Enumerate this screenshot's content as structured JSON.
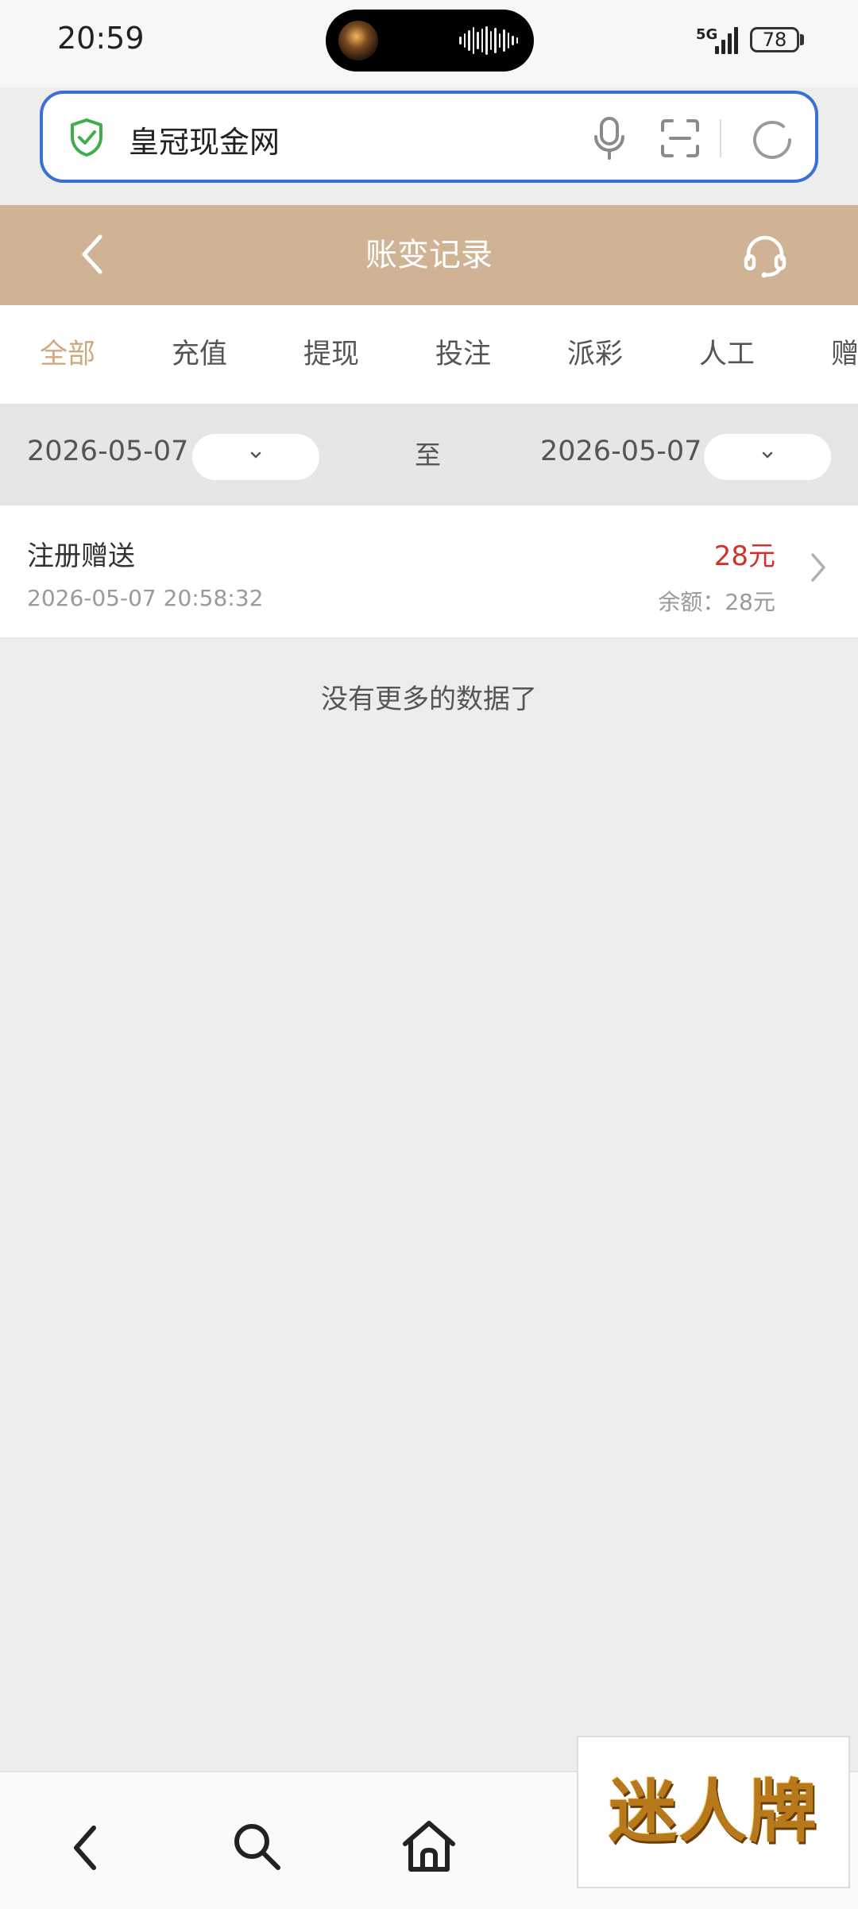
{
  "status_bar": {
    "time": "20:59",
    "network": "5G",
    "battery": "78"
  },
  "search": {
    "query": "皇冠现金网"
  },
  "header": {
    "title": "账变记录"
  },
  "tabs": [
    {
      "label": "全部",
      "active": true
    },
    {
      "label": "充值"
    },
    {
      "label": "提现"
    },
    {
      "label": "投注"
    },
    {
      "label": "派彩"
    },
    {
      "label": "人工"
    },
    {
      "label": "赠"
    }
  ],
  "filter": {
    "start_date": "2026-05-07",
    "separator": "至",
    "end_date": "2026-05-07"
  },
  "records": [
    {
      "title": "注册赠送",
      "time": "2026-05-07 20:58:32",
      "amount": "28元",
      "balance": "余额：28元"
    }
  ],
  "footer_message": "没有更多的数据了",
  "overlay_badge": {
    "text": "迷人牌"
  },
  "colors": {
    "accent": "#cfb394",
    "active_tab": "#cfa97d",
    "amount": "#d0312d",
    "search_border": "#3a6fd8"
  }
}
